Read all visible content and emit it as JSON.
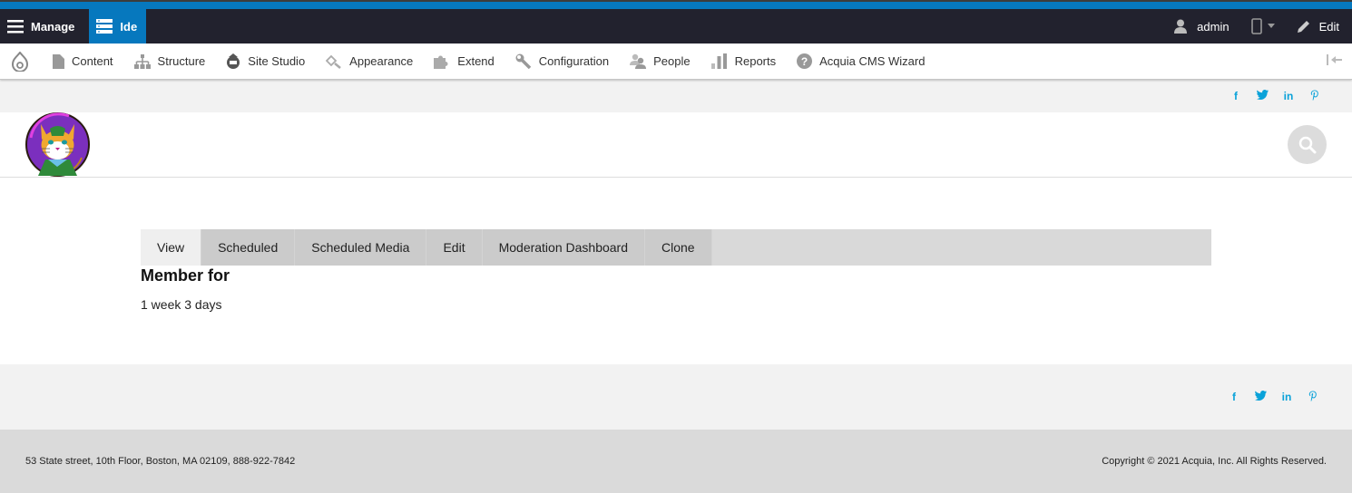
{
  "toolbar": {
    "manage_label": "Manage",
    "ide_label": "Ide",
    "user_label": "admin",
    "edit_label": "Edit",
    "accent_color": "#0678be"
  },
  "tray": {
    "items": [
      {
        "label": "Content",
        "icon": "file-icon"
      },
      {
        "label": "Structure",
        "icon": "sitemap-icon"
      },
      {
        "label": "Site Studio",
        "icon": "site-studio-icon"
      },
      {
        "label": "Appearance",
        "icon": "paintbrush-icon"
      },
      {
        "label": "Extend",
        "icon": "puzzle-icon"
      },
      {
        "label": "Configuration",
        "icon": "wrench-icon"
      },
      {
        "label": "People",
        "icon": "people-icon"
      },
      {
        "label": "Reports",
        "icon": "bar-chart-icon"
      },
      {
        "label": "Acquia CMS Wizard",
        "icon": "question-icon"
      }
    ]
  },
  "social": {
    "facebook": "f",
    "twitter": "twitter",
    "linkedin": "in",
    "pinterest": "p",
    "color": "#0aa2d9"
  },
  "tabs": [
    {
      "label": "View",
      "active": true
    },
    {
      "label": "Scheduled",
      "active": false
    },
    {
      "label": "Scheduled Media",
      "active": false
    },
    {
      "label": "Edit",
      "active": false
    },
    {
      "label": "Moderation Dashboard",
      "active": false
    },
    {
      "label": "Clone",
      "active": false
    }
  ],
  "profile": {
    "member_for_label": "Member for",
    "member_for_value": "1 week 3 days"
  },
  "footer": {
    "address": "53 State street, 10th Floor, Boston, MA 02109, 888-922-7842",
    "copyright": "Copyright © 2021 Acquia, Inc. All Rights Reserved."
  }
}
